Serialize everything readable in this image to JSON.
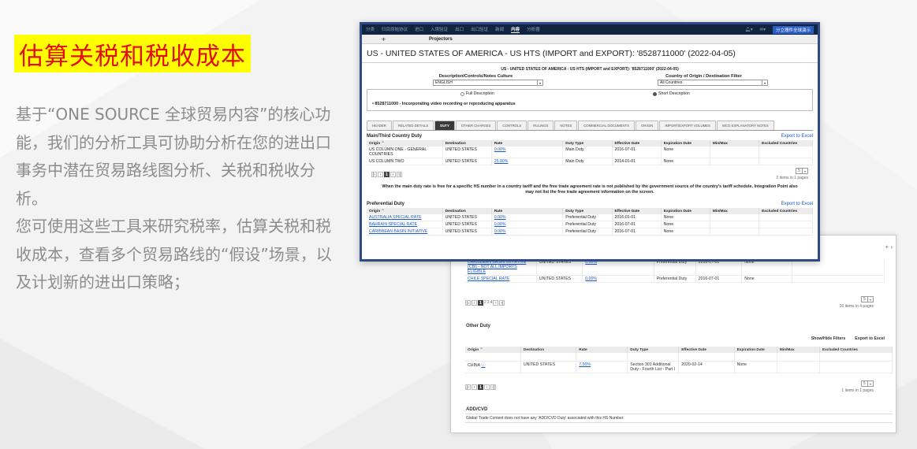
{
  "left": {
    "title": "估算关税和税收成本",
    "para1": "基于“ONE SOURCE 全球贸易内容”的核心功能，我们的分析工具可协助分析在您的进出口事务中潜在贸易路线图分析、关税和税收分析。",
    "para2": "您可使用这些工具来研究税率，估算关税和税收成本，查看多个贸易路线的“假设”场景，以及计划新的进出口策略；"
  },
  "front": {
    "nav": [
      "分类",
      "归目原始协议",
      "进口",
      "入境验证",
      "出口",
      "出口验证",
      "新闻",
      "内容",
      "分析器"
    ],
    "nav_active_index": 7,
    "nav_user": "分立器件全球演示",
    "toolbar_label": "Projectors",
    "page_title": "US - UNITED STATES OF AMERICA - US HTS (IMPORT and EXPORT): '8528711000' (2022-04-05)",
    "small_title": "US - UNITED STATES OF AMERICA - US HTS (IMPORT and EXPORT): '8528711000' (2022-04-05)",
    "desc_label": "Description/Controls/Notes Culture",
    "country_label": "Country of Origin / Destination Filter",
    "language_value": "ENGLISH",
    "country_value": "All Countries",
    "radio_full": "Full Description",
    "radio_short": "Short Description",
    "hs_bullet": "• 8528711000 - Incorporating video recording or reproducing apparatus",
    "tabs": [
      "HEADER",
      "RELATED DETAILS",
      "DUTY",
      "OTHER CHARGES",
      "CONTROLS",
      "RULINGS",
      "NOTES",
      "COMMERCIAL DOCUMENTS",
      "ORIGIN",
      "IMPORT/EXPORT VOLUMES",
      "WCO EXPLANATORY NOTES"
    ],
    "active_tab_index": 2,
    "columns": [
      "Origin ⌃",
      "Destination",
      "Rate",
      "Duty Type",
      "Effective Date",
      "Expiration Date",
      "Min/Max",
      "Excluded Countries"
    ],
    "export_label": "Export to Excel",
    "main_duty_title": "Main/Third Country Duty",
    "main_rows": [
      [
        "US COLUMN ONE - GENERAL COUNTRIES",
        "UNITED STATES",
        "0.00%",
        "Main Duty",
        "2016-07-01",
        "None",
        "",
        ""
      ],
      [
        "US COLUMN TWO",
        "UNITED STATES",
        "25.00%",
        "Main Duty",
        "2014-01-01",
        "None",
        "",
        ""
      ]
    ],
    "pager_page": "1",
    "pager_size": "5",
    "main_items": "2 items in 1 pages",
    "note": "When the main duty rate is free for a specific HS number in a country tariff and the free trade agreement rate is not published by the government source of the country's tariff schedule, Integration Point also may not list the free trade agreement information on the screen.",
    "pref_title": "Preferential Duty",
    "pref_rows": [
      [
        "AUSTRALIA SPECIAL RATE",
        "UNITED STATES",
        "0.00%",
        "Preferential Duty",
        "2016-01-01",
        "None",
        "",
        ""
      ],
      [
        "BAHRAIN SPECIAL RATE",
        "UNITED STATES",
        "0.00%",
        "Preferential Duty",
        "2016-07-01",
        "None",
        "",
        ""
      ],
      [
        "CARIBBEAN BASIN INITIATIVE",
        "UNITED STATES",
        "0.00%",
        "Preferential Duty",
        "2016-07-01",
        "None",
        "",
        ""
      ]
    ]
  },
  "back": {
    "top_rows": [
      [
        "CARIBBEAN BASIN INITIATIVE (CBI) - NOT ALL IMPORTS ELIGIBLE",
        "UNITED STATES",
        "0.00%",
        "Preferential Duty",
        "2016-07-01",
        "None"
      ],
      [
        "CHILE SPECIAL RATE",
        "UNITED STATES",
        "0.00%",
        "Preferential Duty",
        "2016-07-01",
        "None"
      ]
    ],
    "pager_pages": [
      "1",
      "2",
      "3",
      "4"
    ],
    "pref_items": "16 items in 4 pages",
    "other_title": "Other Duty",
    "show_hide": "Show/Hide Filters",
    "export_label": "Export to Excel",
    "columns": [
      "Origin ⌃",
      "Destination",
      "Rate",
      "Duty Type",
      "Effective Date",
      "Expiration Date",
      "Min/Max",
      "Excluded Countries"
    ],
    "other_row": [
      "CHINA",
      "UNITED STATES",
      "7.50%",
      "Section 301 Additional Duty - Fourth List - Part I",
      "2020-02-14",
      "None"
    ],
    "other_items": "1 items in 1 pages",
    "pager_size": "5",
    "addcvd_title": "ADD/CVD",
    "addcvd_text": "Global Trade Content does not have any 'ADD/CVD Duty' associated with this HS Number."
  }
}
